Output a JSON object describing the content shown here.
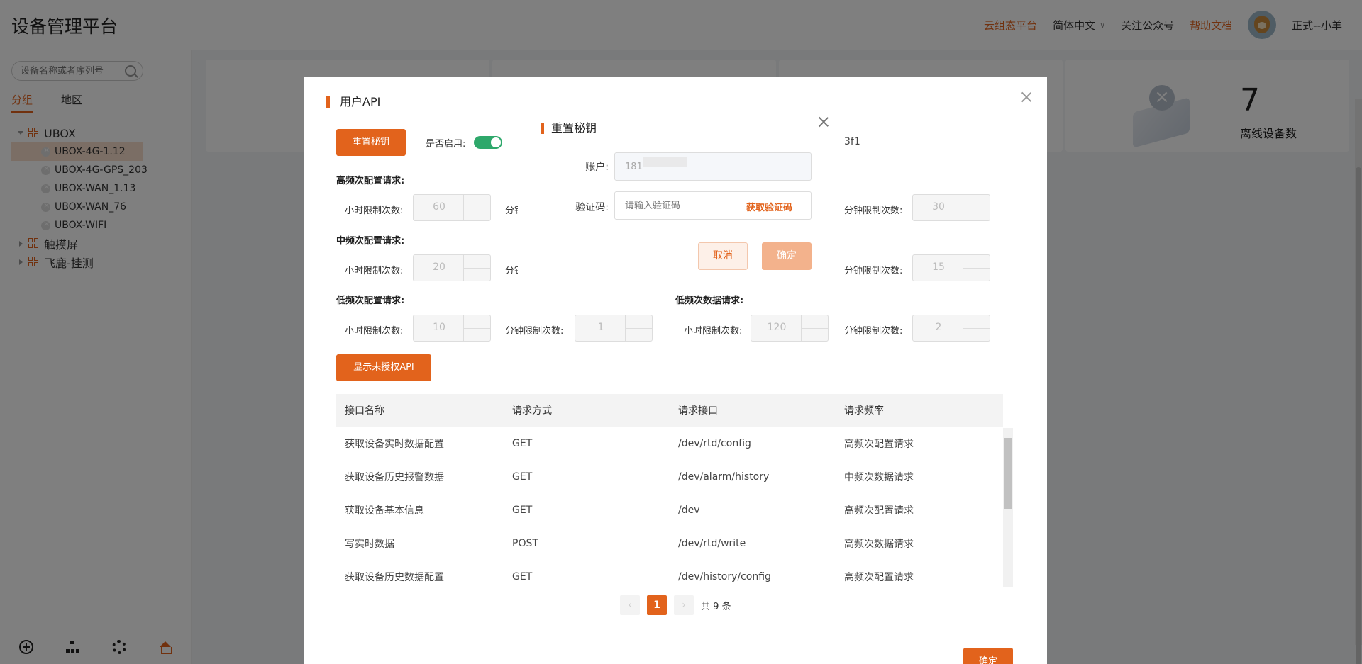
{
  "header": {
    "app_title": "设备管理平台",
    "links": {
      "cloud_config": "云组态平台",
      "language": "简体中文",
      "follow_account": "关注公众号",
      "help_docs": "帮助文档",
      "user_name": "正式--小羊"
    }
  },
  "sidebar": {
    "search_placeholder": "设备名称或者序列号",
    "tabs": [
      "分组",
      "地区"
    ],
    "tree": {
      "groups": [
        {
          "label": "UBOX",
          "expanded": true,
          "children": [
            "UBOX-4G-1.12",
            "UBOX-4G-GPS_203",
            "UBOX-WAN_1.13",
            "UBOX-WAN_76",
            "UBOX-WIFI"
          ]
        },
        {
          "label": "触摸屏",
          "expanded": false
        },
        {
          "label": "飞鹿-挂测",
          "expanded": false
        }
      ]
    },
    "bottom_icons": [
      "add-icon",
      "org-tree-icon",
      "gear-icon",
      "home-icon"
    ]
  },
  "dashboard": {
    "offline_count": "7",
    "offline_label": "离线设备数"
  },
  "api_dialog": {
    "title": "用户API",
    "reset_button": "重置秘钥",
    "enable_label": "是否启用:",
    "enabled": true,
    "key_tail": "3f1",
    "sections": {
      "high_config": {
        "title": "高频次配置请求:",
        "hour_label": "小时限制次数:",
        "hour_value": "60",
        "minute_label": "分钟限制次数:"
      },
      "high_data": {
        "minute_label": "分钟限制次数:",
        "minute_value": "30"
      },
      "mid_config": {
        "title": "中频次配置请求:",
        "hour_label": "小时限制次数:",
        "hour_value": "20",
        "minute_label": "分钟限制次数:"
      },
      "mid_data": {
        "minute_label": "分钟限制次数:",
        "minute_value": "15"
      },
      "low_config": {
        "title": "低频次配置请求:",
        "hour_label": "小时限制次数:",
        "hour_value": "10",
        "minute_label": "分钟限制次数:",
        "minute_value": "1"
      },
      "low_data": {
        "title": "低频次数据请求:",
        "hour_label": "小时限制次数:",
        "hour_value": "120",
        "minute_label": "分钟限制次数:",
        "minute_value": "2"
      }
    },
    "show_unauth_button": "显示未授权API",
    "table": {
      "headers": [
        "接口名称",
        "请求方式",
        "请求接口",
        "请求频率"
      ],
      "rows": [
        [
          "获取设备实时数据配置",
          "GET",
          "/dev/rtd/config",
          "高频次配置请求"
        ],
        [
          "获取设备历史报警数据",
          "GET",
          "/dev/alarm/history",
          "中频次数据请求"
        ],
        [
          "获取设备基本信息",
          "GET",
          "/dev",
          "高频次配置请求"
        ],
        [
          "写实时数据",
          "POST",
          "/dev/rtd/write",
          "高频次数据请求"
        ],
        [
          "获取设备历史数据配置",
          "GET",
          "/dev/history/config",
          "高频次配置请求"
        ]
      ]
    },
    "pager": {
      "prev": "‹",
      "current": "1",
      "next": "›",
      "total": "共 9 条"
    },
    "confirm_button": "确定"
  },
  "reset_modal": {
    "title": "重置秘钥",
    "account_label": "账户:",
    "account_value": "181",
    "code_label": "验证码:",
    "code_placeholder": "请输入验证码",
    "get_code": "获取验证码",
    "cancel": "取消",
    "confirm": "确定"
  },
  "colors": {
    "accent": "#e2631c",
    "toggle_on": "#2ea86b"
  }
}
